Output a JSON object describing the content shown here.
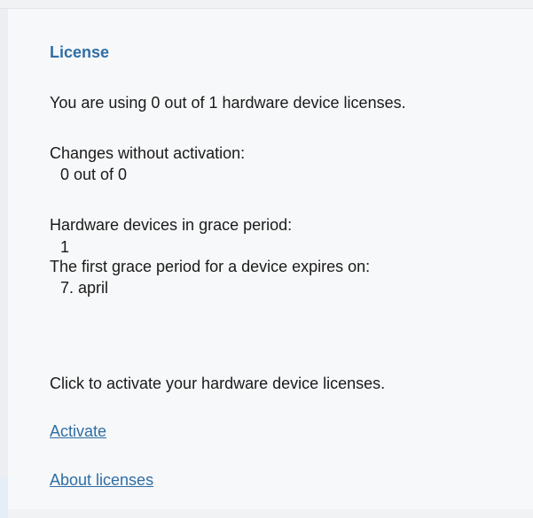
{
  "license": {
    "title": "License",
    "usage_text": "You are using 0 out of 1 hardware device licenses.",
    "changes_label": "Changes without activation:",
    "changes_value": "0 out of 0",
    "grace_label": "Hardware devices in grace period:",
    "grace_value": "1",
    "expires_label": "The first grace period for a device expires on:",
    "expires_value": "7. april",
    "activate_hint": "Click to activate your hardware device licenses.",
    "activate_link": "Activate",
    "about_link": "About licenses"
  },
  "colors": {
    "accent": "#2f6ea5",
    "text": "#1a1a1a",
    "panel_bg": "#f7f8f9"
  }
}
